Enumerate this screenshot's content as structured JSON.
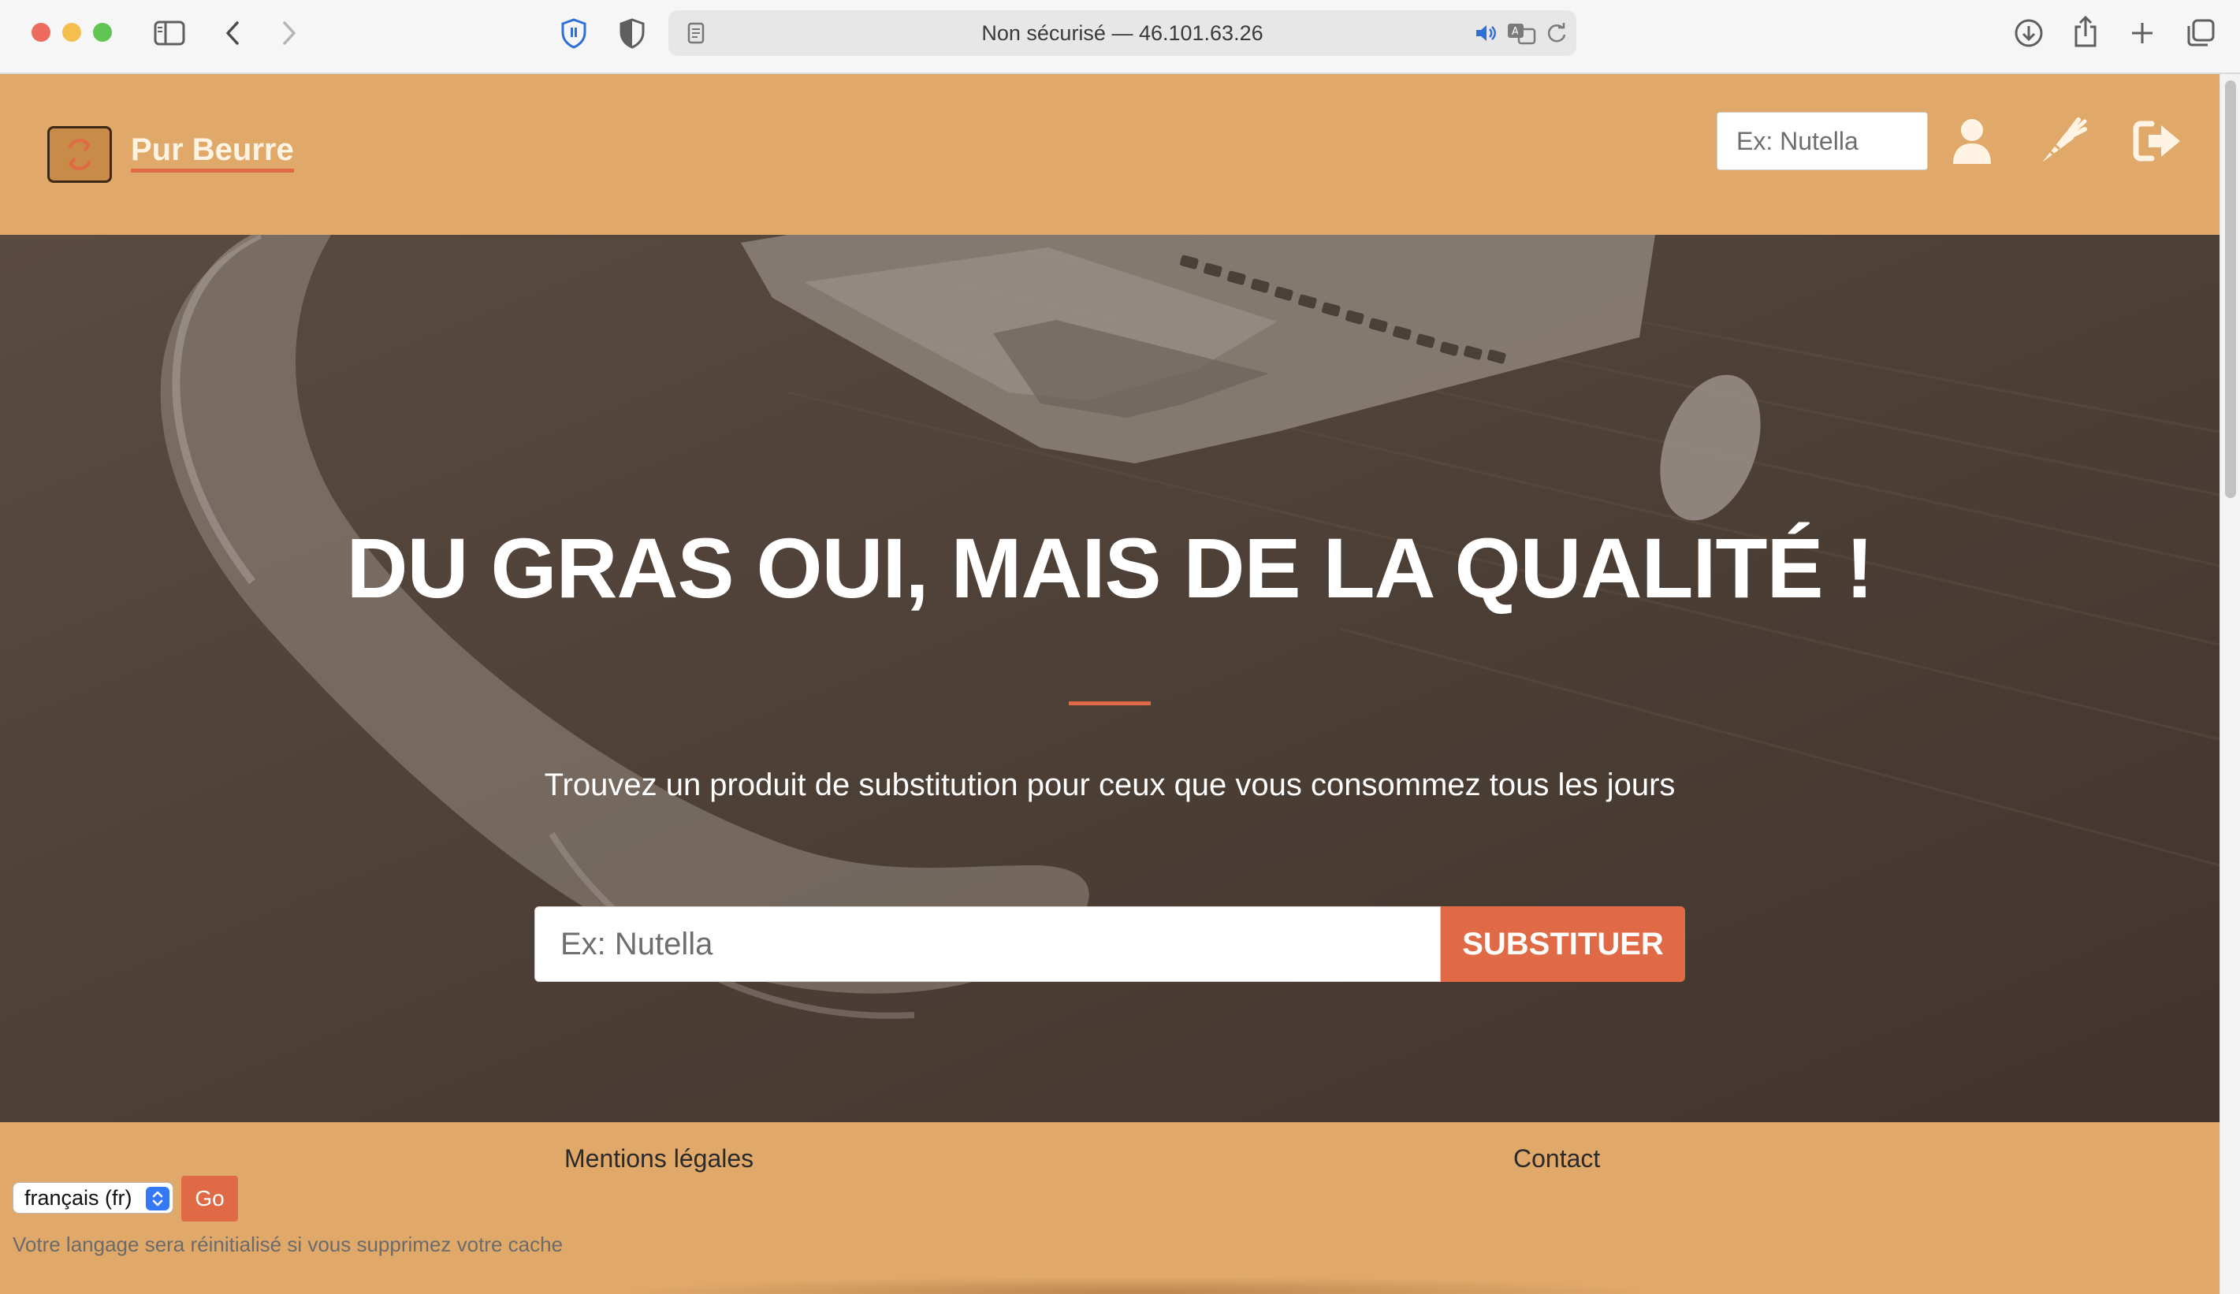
{
  "browser": {
    "address_text": "Non sécurisé — 46.101.63.26"
  },
  "header": {
    "brand": "Pur Beurre",
    "search_placeholder": "Ex: Nutella",
    "icons": [
      "user-icon",
      "carrot-icon",
      "sign-out-icon"
    ]
  },
  "hero": {
    "title": "DU GRAS OUI, MAIS DE LA QUALITÉ !",
    "subtitle": "Trouvez un produit de substitution pour ceux que vous consommez tous les jours",
    "search_placeholder": "Ex: Nutella",
    "button_label": "SUBSTITUER"
  },
  "footer": {
    "legal_link": "Mentions légales",
    "contact_link": "Contact",
    "language_selected": "français (fr)",
    "go_label": "Go",
    "language_note": "Votre langage sera réinitialisé si vous supprimez votre cache"
  },
  "colors": {
    "accent": "#e06a45",
    "header_bg": "#e0a96a",
    "hero_overlay": "#4b3e35"
  }
}
